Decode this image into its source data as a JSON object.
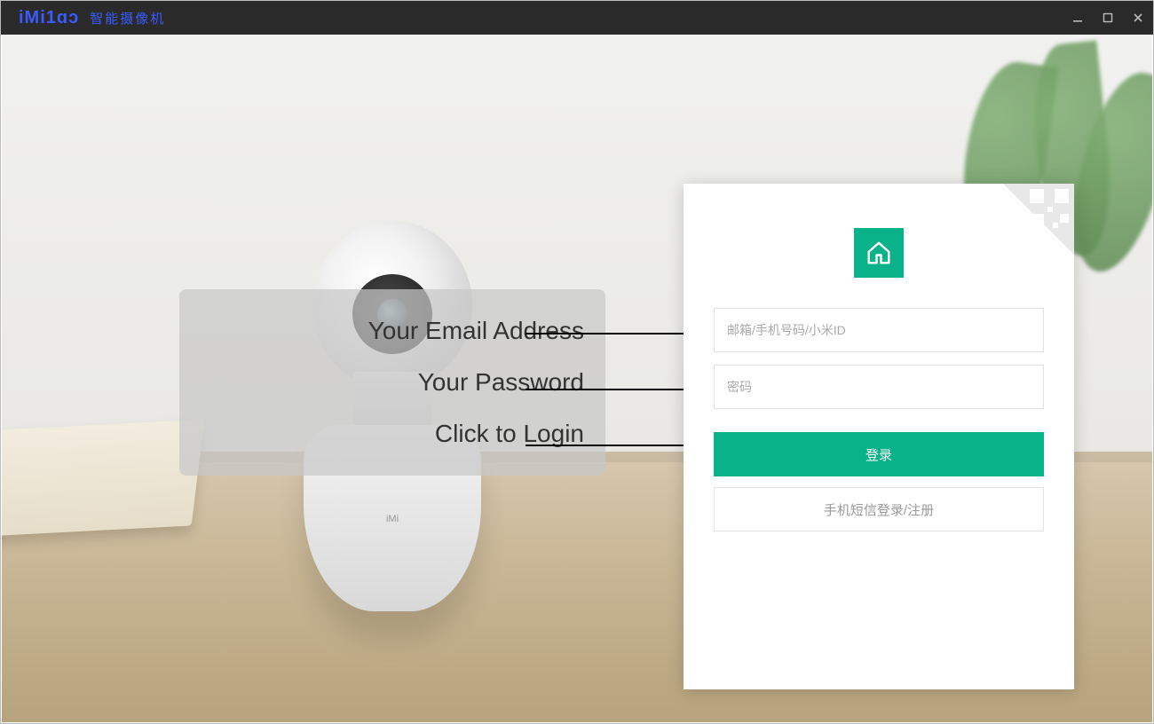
{
  "titlebar": {
    "brand": "iMi1ɑɔ",
    "brand_sub": "智能摄像机"
  },
  "annotations": {
    "email": "Your Email Address",
    "password": "Your Password",
    "login": "Click to Login"
  },
  "login": {
    "email_placeholder": "邮箱/手机号码/小米ID",
    "password_placeholder": "密码",
    "login_label": "登录",
    "sms_login_label": "手机短信登录/注册"
  }
}
